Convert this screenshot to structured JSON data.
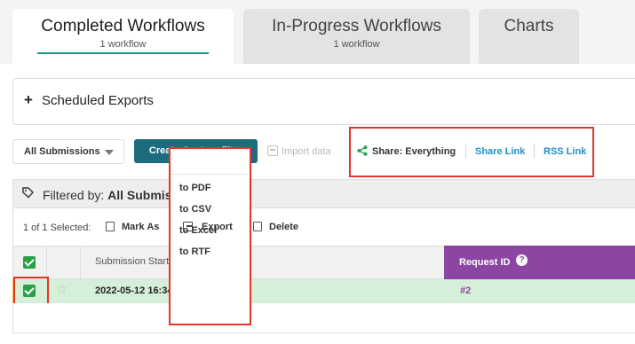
{
  "tabs": [
    {
      "label": "Completed Workflows",
      "sub": "1 workflow",
      "active": true
    },
    {
      "label": "In-Progress Workflows",
      "sub": "1 workflow",
      "active": false
    },
    {
      "label": "Charts",
      "sub": "",
      "active": false
    }
  ],
  "scheduled": {
    "label": "Scheduled Exports"
  },
  "toolbar": {
    "filter_select": "All Submissions",
    "create_filter": "Create Custom filter",
    "import": "Import data",
    "share": "Share: Everything",
    "share_link": "Share Link",
    "rss_link": "RSS Link"
  },
  "filter": {
    "prefix": "Filtered by:",
    "value": "All Submissions"
  },
  "actions": {
    "selected": "1 of 1 Selected:",
    "mark_as": "Mark As",
    "export": "Export",
    "delete": "Delete"
  },
  "export_menu": [
    "to PDF",
    "to CSV",
    "to Excel",
    "to RTF"
  ],
  "table": {
    "col_submission": "Submission Start",
    "col_request": "Request ID",
    "rows": [
      {
        "date": "2022-05-12 16:34",
        "request": "#2"
      }
    ]
  },
  "colors": {
    "teal": "#1e6b7e",
    "purple": "#8b45a3",
    "highlight": "#e2372a",
    "row_selected": "#d6efd9"
  }
}
